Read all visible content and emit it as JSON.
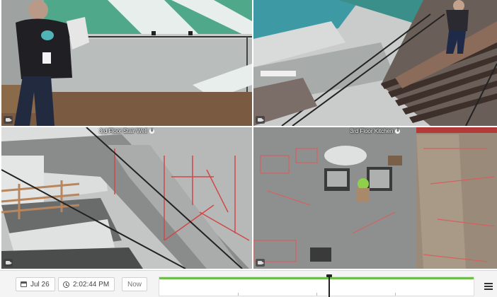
{
  "cameras": [
    {
      "id": "cam-1",
      "label": "",
      "icon": "camera-icon"
    },
    {
      "id": "cam-2",
      "label": "",
      "icon": "camera-icon"
    },
    {
      "id": "cam-3",
      "label": "3rd Floor Stair Well",
      "icon": "camera-icon",
      "info_icon": "info-icon"
    },
    {
      "id": "cam-4",
      "label": "3rd Floor Kitchen",
      "icon": "camera-icon",
      "info_icon": "info-icon"
    }
  ],
  "timeline": {
    "date": "Jul 26",
    "time": "2:02:44 PM",
    "now_label": "Now",
    "date_icon": "calendar-icon",
    "time_icon": "clock-icon",
    "expand_icon": "expand-icon",
    "recorded_fraction": 1.0,
    "playhead_fraction": 0.54,
    "accent_color": "#6cbf4a"
  }
}
